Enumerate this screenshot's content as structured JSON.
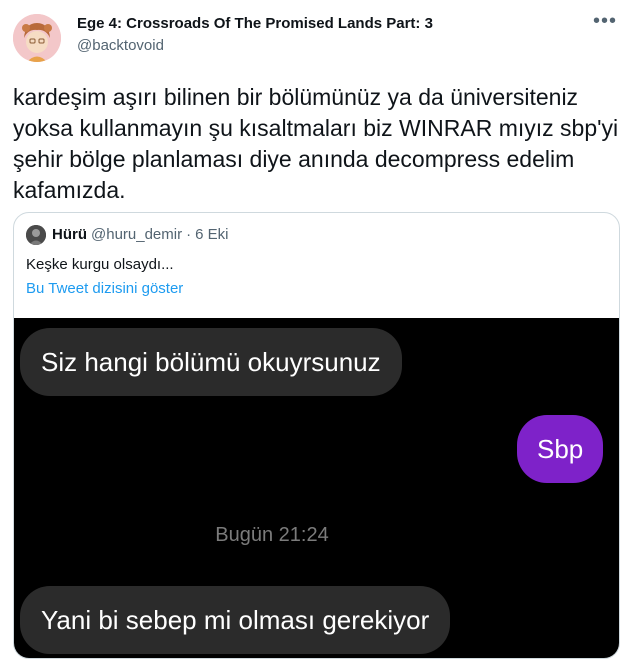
{
  "author": {
    "name": "Ege 4: Crossroads Of The Promised Lands Part: 3",
    "handle": "@backtovoid"
  },
  "more_icon": "more-horizontal-icon",
  "tweet": {
    "text": "kardeşim aşırı bilinen bir bölümünüz ya da üniversiteniz yoksa kullanmayın şu kısaltmaları biz WINRAR mıyız sbp'yi şehir bölge planlaması diye anında decompress edelim kafamızda."
  },
  "quote": {
    "name": "Hürü",
    "handle": "@huru_demir",
    "separator": "·",
    "date": "6 Eki",
    "text": "Keşke kurgu olsaydı...",
    "thread_link": "Bu Tweet dizisini göster"
  },
  "chat": {
    "message_1": "Siz hangi bölümü okuyrsunuz",
    "reply_1": "Sbp",
    "time": "Bugün 21:24",
    "message_2": "Yani bi sebep mi olması gerekiyor"
  },
  "colors": {
    "accent_link": "#1d9bf0",
    "outgoing_bubble": "#7e22c9",
    "incoming_bubble": "#2b2b2b"
  }
}
